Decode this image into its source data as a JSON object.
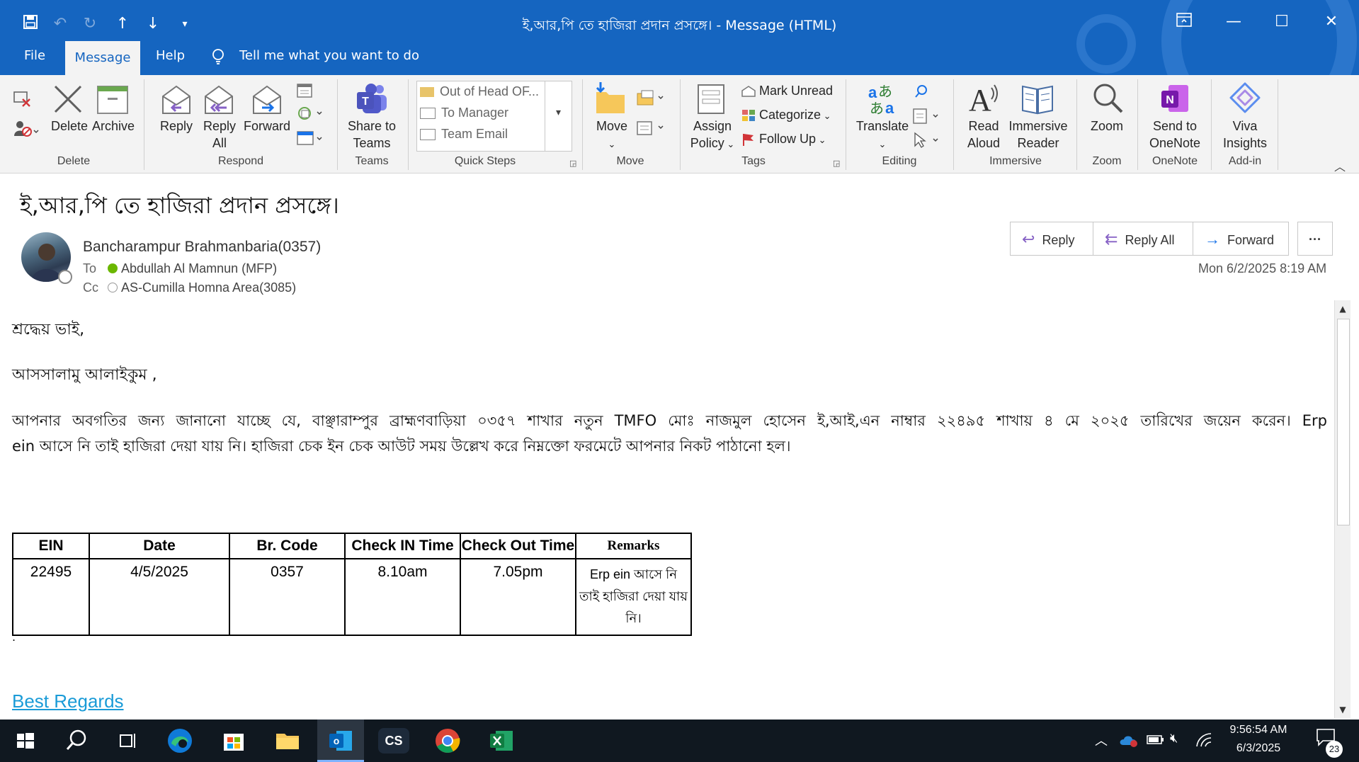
{
  "window": {
    "title": "ই,আর,পি তে হাজিরা প্রদান প্রসঙ্গে। - Message (HTML)"
  },
  "menu": {
    "file": "File",
    "message": "Message",
    "help": "Help",
    "tell_me": "Tell me what you want to do"
  },
  "ribbon": {
    "delete_group": {
      "delete": "Delete",
      "archive": "Archive",
      "label": "Delete"
    },
    "respond_group": {
      "reply": "Reply",
      "reply_all_1": "Reply",
      "reply_all_2": "All",
      "forward": "Forward",
      "label": "Respond"
    },
    "teams_group": {
      "share_1": "Share to",
      "share_2": "Teams",
      "label": "Teams"
    },
    "quick_steps": {
      "items": [
        "Out of Head OF...",
        "To Manager",
        "Team Email"
      ],
      "label": "Quick Steps"
    },
    "move_group": {
      "move": "Move",
      "label": "Move"
    },
    "tags_group": {
      "assign_1": "Assign",
      "assign_2": "Policy",
      "mark_unread": "Mark Unread",
      "categorize": "Categorize",
      "follow_up": "Follow Up",
      "label": "Tags"
    },
    "editing_group": {
      "translate": "Translate",
      "label": "Editing"
    },
    "immersive_group": {
      "read_1": "Read",
      "read_2": "Aloud",
      "imm_1": "Immersive",
      "imm_2": "Reader",
      "label": "Immersive"
    },
    "zoom_group": {
      "zoom": "Zoom",
      "label": "Zoom"
    },
    "onenote_group": {
      "send_1": "Send to",
      "send_2": "OneNote",
      "label": "OneNote"
    },
    "addin_group": {
      "viva_1": "Viva",
      "viva_2": "Insights",
      "label": "Add-in"
    }
  },
  "message": {
    "subject": "ই,আর,পি তে হাজিরা প্রদান প্রসঙ্গে।",
    "sender": "Bancharampur Brahmanbaria(0357)",
    "to_label": "To",
    "to": "Abdullah Al Mamnun (MFP)",
    "cc_label": "Cc",
    "cc": "AS-Cumilla Homna Area(3085)",
    "date": "Mon 6/2/2025 8:19 AM",
    "actions": {
      "reply": "Reply",
      "reply_all": "Reply All",
      "forward": "Forward",
      "more": "···"
    },
    "body": {
      "greeting": "শ্রদ্ধেয় ভাই,",
      "salam": "আসসালামু আলাইকুম ,",
      "para_line1": "আপনার অবগতির জন্য জানানো যাচ্ছে যে, বাঞ্ছারাম্পুর ব্রাহ্মণবাড়িয়া ০৩৫৭ শাখার নতুন TMFO মোঃ নাজমুল হোসেন ই,আই,এন নাম্বার ২২৪৯৫ শাখায় ৪ মে ২০২৫ তারিখের জয়েন করেন। Erp",
      "para_line2": "ein আসে নি তাই হাজিরা দেয়া যায় নি। হাজিরা চেক ইন চেক আউট সময় উল্লেখ করে নিম্নক্তো ফরমেটে আপনার নিকট পাঠানো হল।",
      "dot": ".",
      "regards": "Best Regards"
    },
    "table": {
      "headers": [
        "EIN",
        "Date",
        "Br. Code",
        "Check IN Time",
        "Check Out Time",
        "Remarks"
      ],
      "row": [
        "22495",
        "4/5/2025",
        "0357",
        "8.10am",
        "7.05pm",
        "Erp ein আসে নি তাই হাজিরা দেয়া যায় নি।"
      ]
    }
  },
  "taskbar": {
    "time": "9:56:54 AM",
    "date": "6/3/2025",
    "notifications": "23"
  },
  "colors": {
    "accent": "#1565c0",
    "taskbar": "#101820",
    "ribbon": "#f3f3f3"
  }
}
